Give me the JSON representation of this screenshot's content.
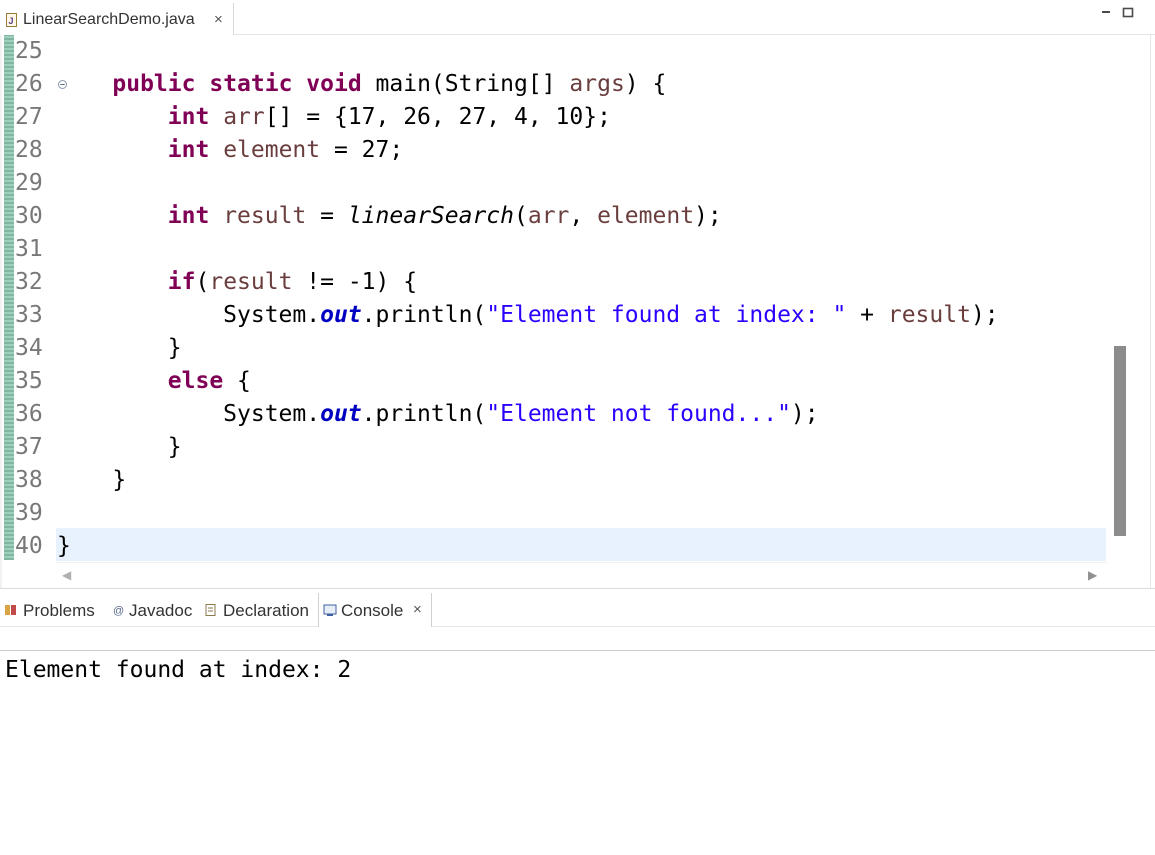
{
  "editor_tab": {
    "filename": "LinearSearchDemo.java",
    "close_glyph": "×"
  },
  "window_controls": {
    "minimize_glyph": "‒",
    "maximize_glyph": "□"
  },
  "editor": {
    "lines": [
      {
        "num": "25",
        "tokens": []
      },
      {
        "num": "26",
        "fold": true,
        "tokens": [
          {
            "t": "    "
          },
          {
            "t": "public",
            "c": "kw"
          },
          {
            "t": " "
          },
          {
            "t": "static",
            "c": "kw"
          },
          {
            "t": " "
          },
          {
            "t": "void",
            "c": "kw"
          },
          {
            "t": " main(String[] "
          },
          {
            "t": "args",
            "c": "var"
          },
          {
            "t": ") {"
          }
        ]
      },
      {
        "num": "27",
        "tokens": [
          {
            "t": "        "
          },
          {
            "t": "int",
            "c": "kw"
          },
          {
            "t": " "
          },
          {
            "t": "arr",
            "c": "var"
          },
          {
            "t": "[] = {17, 26, 27, 4, 10};"
          }
        ]
      },
      {
        "num": "28",
        "tokens": [
          {
            "t": "        "
          },
          {
            "t": "int",
            "c": "kw"
          },
          {
            "t": " "
          },
          {
            "t": "element",
            "c": "var"
          },
          {
            "t": " = 27;"
          }
        ]
      },
      {
        "num": "29",
        "tokens": []
      },
      {
        "num": "30",
        "tokens": [
          {
            "t": "        "
          },
          {
            "t": "int",
            "c": "kw"
          },
          {
            "t": " "
          },
          {
            "t": "result",
            "c": "var"
          },
          {
            "t": " = "
          },
          {
            "t": "linearSearch",
            "c": "smeth"
          },
          {
            "t": "("
          },
          {
            "t": "arr",
            "c": "var"
          },
          {
            "t": ", "
          },
          {
            "t": "element",
            "c": "var"
          },
          {
            "t": ");"
          }
        ]
      },
      {
        "num": "31",
        "tokens": []
      },
      {
        "num": "32",
        "tokens": [
          {
            "t": "        "
          },
          {
            "t": "if",
            "c": "kw"
          },
          {
            "t": "("
          },
          {
            "t": "result",
            "c": "var"
          },
          {
            "t": " != -1) {"
          }
        ]
      },
      {
        "num": "33",
        "tokens": [
          {
            "t": "            System."
          },
          {
            "t": "out",
            "c": "fld"
          },
          {
            "t": ".println("
          },
          {
            "t": "\"Element found at index: \"",
            "c": "str"
          },
          {
            "t": " + "
          },
          {
            "t": "result",
            "c": "var"
          },
          {
            "t": ");"
          }
        ]
      },
      {
        "num": "34",
        "tokens": [
          {
            "t": "        }"
          }
        ]
      },
      {
        "num": "35",
        "tokens": [
          {
            "t": "        "
          },
          {
            "t": "else",
            "c": "kw"
          },
          {
            "t": " {"
          }
        ]
      },
      {
        "num": "36",
        "tokens": [
          {
            "t": "            System."
          },
          {
            "t": "out",
            "c": "fld"
          },
          {
            "t": ".println("
          },
          {
            "t": "\"Element not found...\"",
            "c": "str"
          },
          {
            "t": ");"
          }
        ]
      },
      {
        "num": "37",
        "tokens": [
          {
            "t": "        }"
          }
        ]
      },
      {
        "num": "38",
        "tokens": [
          {
            "t": "    }"
          }
        ]
      },
      {
        "num": "39",
        "tokens": []
      },
      {
        "num": "40",
        "current": true,
        "tokens": [
          {
            "t": "}"
          }
        ]
      }
    ]
  },
  "panel": {
    "tabs": [
      {
        "id": "problems",
        "label": "Problems",
        "icon": "problems-icon"
      },
      {
        "id": "javadoc",
        "label": "Javadoc",
        "icon": "javadoc-icon"
      },
      {
        "id": "declaration",
        "label": "Declaration",
        "icon": "declaration-icon"
      },
      {
        "id": "console",
        "label": "Console",
        "icon": "console-icon",
        "active": true,
        "close_glyph": "×"
      }
    ]
  },
  "console": {
    "output": "Element found at index: 2"
  },
  "colors": {
    "keyword": "#7f0055",
    "local_variable": "#6a3e3e",
    "string": "#2a00ff",
    "static_field": "#0000c0",
    "current_line": "#e8f2fe"
  }
}
